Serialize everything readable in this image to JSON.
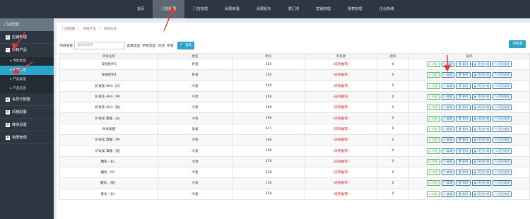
{
  "top_nav": [
    "首页",
    "门店配置",
    "门店管理",
    "消费幸福",
    "消费股东",
    "潜汇增",
    "营销管理",
    "报表管理",
    "企业商城"
  ],
  "top_nav_active": 1,
  "sidebar": {
    "title": "门店配置",
    "items": [
      {
        "label": "店铺管理"
      },
      {
        "label": "项目产品",
        "children": [
          {
            "label": "项目类型",
            "active": false
          },
          {
            "label": "项目信息",
            "active": true
          },
          {
            "label": "产品类型",
            "active": false
          },
          {
            "label": "产品信息",
            "active": false
          }
        ]
      },
      {
        "label": "会员卡配置"
      },
      {
        "label": "风格配置"
      },
      {
        "label": "微信设置"
      },
      {
        "label": "权限管理"
      }
    ]
  },
  "breadcrumb": [
    "门店配置",
    "项目产品",
    "项目信息"
  ],
  "filter": {
    "name_label": "项目名称",
    "name_placeholder": "搜索关键字",
    "type_label": "选择类型",
    "type_value": "所有类型",
    "status_label": "状态",
    "status_value": "所有",
    "search_label": "查询"
  },
  "add_label": "添新增",
  "table": {
    "headers": [
      "项目名称",
      "类型",
      "原价",
      "手机端",
      "顺序",
      "操作"
    ],
    "rows": [
      [
        "深层修护3",
        "护发",
        "120",
        "(未购推荐)",
        "0"
      ],
      [
        "深层修护4",
        "护发",
        "150",
        "(未购推荐)",
        "0"
      ],
      [
        "护发美 AHA（长）",
        "冷烫",
        "408",
        "(未购推荐)",
        "0"
      ],
      [
        "护发美 AHA（中）",
        "冷烫",
        "358",
        "(未购推荐)",
        "0"
      ],
      [
        "护发美 AHA（短）",
        "冷烫",
        "308",
        "(未购推荐)",
        "0"
      ],
      [
        "护发美 典雅（长）",
        "冷烫",
        "298",
        "(未购推荐)",
        "0"
      ],
      [
        "时尚发膜",
        "烫发",
        "611",
        "(未购推荐)",
        "0"
      ],
      [
        "护发美 典雅（中）",
        "冷烫",
        "268",
        "(未购推荐)",
        "0"
      ],
      [
        "护发美 典雅（短）",
        "冷烫",
        "198",
        "(未购推荐)",
        "0"
      ],
      [
        "魔焰（长）",
        "冷烫",
        "278",
        "(未购推荐)",
        "0"
      ],
      [
        "魔焰（中）",
        "冷烫",
        "218",
        "(未购推荐)",
        "0"
      ],
      [
        "魔焰 （短）",
        "冷烫",
        "158",
        "(未购推荐)",
        "0"
      ],
      [
        "春坎（长）",
        "冷烫",
        "238",
        "(未购推荐)",
        "0"
      ]
    ],
    "actions": [
      "浏览",
      "编辑",
      "删除",
      "项目价格",
      "项目描述"
    ]
  }
}
